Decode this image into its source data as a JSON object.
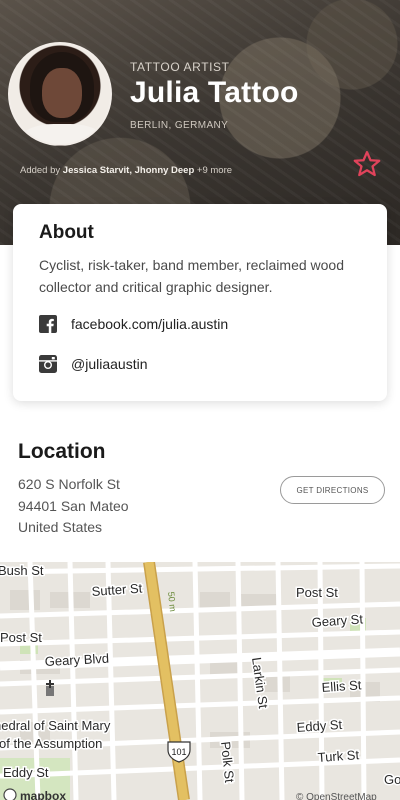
{
  "profile": {
    "role": "TATTOO ARTIST",
    "name": "Julia Tattoo",
    "location": "BERLIN, GERMANY",
    "added_prefix": "Added by",
    "added_by": "Jessica Starvit, Jhonny Deep",
    "added_more": "+9 more"
  },
  "about": {
    "title": "About",
    "text": "Cyclist, risk-taker, band member, reclaimed wood collector and critical graphic designer.",
    "facebook": "facebook.com/julia.austin",
    "instagram": "@juliaaustin"
  },
  "location": {
    "title": "Location",
    "line1": "620 S Norfolk St",
    "line2": "94401 San Mateo",
    "line3": "United States",
    "directions_label": "GET DIRECTIONS"
  },
  "map": {
    "streets": [
      "Bush St",
      "Sutter St",
      "Post St",
      "Post St",
      "Geary St",
      "Geary Blvd",
      "Larkin St",
      "Ellis St",
      "Eddy St",
      "Eddy St",
      "Turk St",
      "Polk St",
      "50 m"
    ],
    "landmark": "Cathedral of Saint Mary of the Assumption",
    "landmark_line1": "hedral of Saint Mary",
    "landmark_line2": "of the Assumption",
    "highway": "101",
    "logo": "mapbox",
    "attribution": "© OpenStreetMap",
    "edge_label": "Go"
  },
  "colors": {
    "accent": "#e0435b",
    "highway": "#e3c062"
  }
}
